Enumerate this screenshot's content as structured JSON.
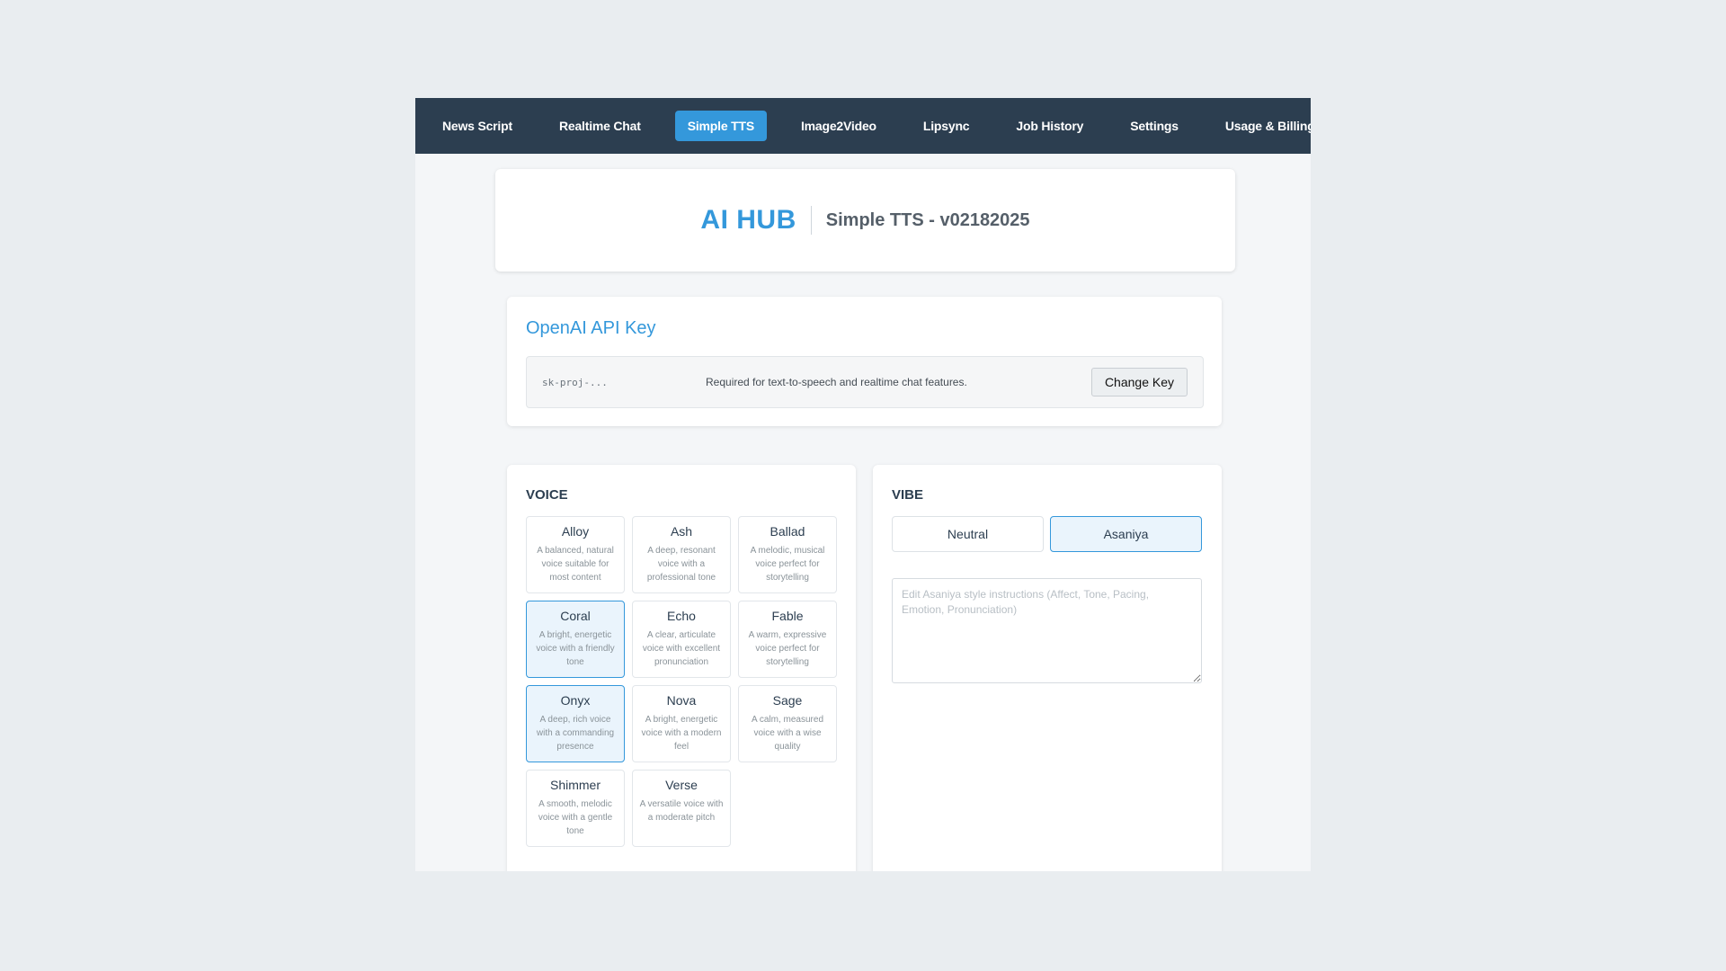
{
  "nav": {
    "items": [
      {
        "label": "News Script"
      },
      {
        "label": "Realtime Chat"
      },
      {
        "label": "Simple TTS"
      },
      {
        "label": "Image2Video"
      },
      {
        "label": "Lipsync"
      },
      {
        "label": "Job History"
      },
      {
        "label": "Settings"
      },
      {
        "label": "Usage & Billing"
      }
    ],
    "active": "Simple TTS"
  },
  "header": {
    "brand": "AI HUB",
    "subtitle": "Simple TTS - v02182025"
  },
  "api": {
    "title": "OpenAI API Key",
    "key_value": "sk-proj-...",
    "help": "Required for text-to-speech and realtime chat features.",
    "change_label": "Change Key"
  },
  "voice": {
    "title": "VOICE",
    "items": [
      {
        "name": "Alloy",
        "desc": "A balanced, natural voice suitable for most content",
        "selected": false
      },
      {
        "name": "Ash",
        "desc": "A deep, resonant voice with a professional tone",
        "selected": false
      },
      {
        "name": "Ballad",
        "desc": "A melodic, musical voice perfect for storytelling",
        "selected": false
      },
      {
        "name": "Coral",
        "desc": "A bright, energetic voice with a friendly tone",
        "selected": true
      },
      {
        "name": "Echo",
        "desc": "A clear, articulate voice with excellent pronunciation",
        "selected": false
      },
      {
        "name": "Fable",
        "desc": "A warm, expressive voice perfect for storytelling",
        "selected": false
      },
      {
        "name": "Onyx",
        "desc": "A deep, rich voice with a commanding presence",
        "selected": true
      },
      {
        "name": "Nova",
        "desc": "A bright, energetic voice with a modern feel",
        "selected": false
      },
      {
        "name": "Sage",
        "desc": "A calm, measured voice with a wise quality",
        "selected": false
      },
      {
        "name": "Shimmer",
        "desc": "A smooth, melodic voice with a gentle tone",
        "selected": false
      },
      {
        "name": "Verse",
        "desc": "A versatile voice with a moderate pitch",
        "selected": false
      }
    ]
  },
  "vibe": {
    "title": "VIBE",
    "options": [
      {
        "label": "Neutral",
        "active": false
      },
      {
        "label": "Asaniya",
        "active": true
      }
    ],
    "instructions_value": "",
    "instructions_placeholder": "Edit Asaniya style instructions (Affect, Tone, Pacing, Emotion, Pronunciation)"
  },
  "colors": {
    "nav_bg": "#2c3e50",
    "accent": "#3498db",
    "page_bg": "#e9edf0"
  }
}
